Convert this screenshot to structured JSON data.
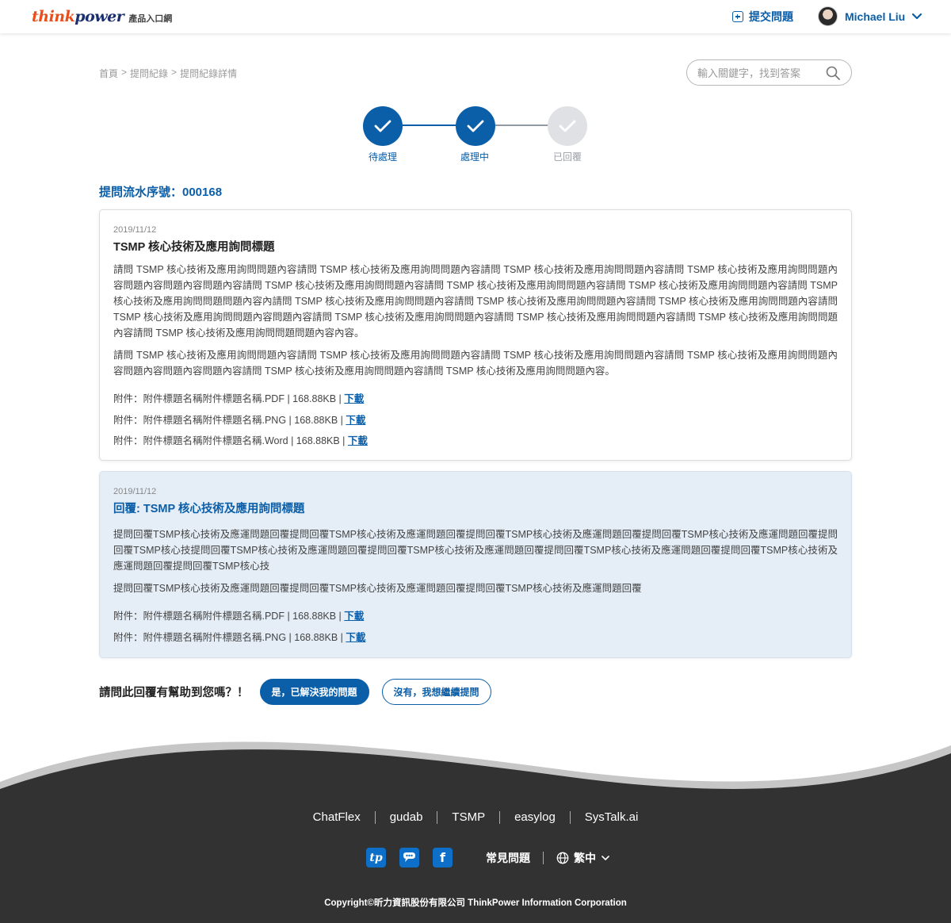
{
  "header": {
    "logo_text_prefix": "think",
    "logo_text_suffix": "power",
    "logo_subtitle": "產品入口網",
    "submit_question_label": "提交問題",
    "user_name": "Michael Liu"
  },
  "breadcrumb": {
    "items": [
      "首頁",
      "提問紀錄",
      "提問紀錄詳情"
    ],
    "separator": ">"
  },
  "search": {
    "placeholder": "輸入關鍵字，找到答案"
  },
  "steps": [
    {
      "label": "待處理",
      "status": "completed"
    },
    {
      "label": "處理中",
      "status": "completed"
    },
    {
      "label": "已回覆",
      "status": "pending"
    }
  ],
  "serial": {
    "label": "提問流水序號：000168"
  },
  "question": {
    "date": "2019/11/12",
    "title": "TSMP 核心技術及應用詢問標題",
    "paragraphs": [
      "請問 TSMP 核心技術及應用詢問問題內容請問 TSMP 核心技術及應用詢問問題內容請問 TSMP 核心技術及應用詢問問題內容請問 TSMP 核心技術及應用詢問問題內容問題內容問題內容問題內容請問 TSMP 核心技術及應用詢問問題內容請問 TSMP 核心技術及應用詢問問題內容請問 TSMP 核心技術及應用詢問問題內容請問 TSMP 核心技術及應用詢問問題問題內容內請問 TSMP 核心技術及應用詢問問題內容請問 TSMP 核心技術及應用詢問問題內容請問 TSMP 核心技術及應用詢問問題內容請問 TSMP 核心技術及應用詢問問題內容問題內容請問 TSMP 核心技術及應用詢問問題內容請問 TSMP 核心技術及應用詢問問題內容請問 TSMP 核心技術及應用詢問問題內容請問 TSMP 核心技術及應用詢問問題問題內容內容。",
      "請問 TSMP 核心技術及應用詢問問題內容請問 TSMP 核心技術及應用詢問問題內容請問 TSMP 核心技術及應用詢問問題內容請問 TSMP 核心技術及應用詢問問題內容問題內容問題內容問題內容請問 TSMP 核心技術及應用詢問問題內容請問 TSMP 核心技術及應用詢問問題內容。"
    ],
    "attachments": [
      {
        "text": "附件：附件標題名稱附件標題名稱.PDF | 168.88KB |",
        "link": "下載"
      },
      {
        "text": "附件：附件標題名稱附件標題名稱.PNG | 168.88KB |",
        "link": "下載"
      },
      {
        "text": "附件：附件標題名稱附件標題名稱.Word | 168.88KB |",
        "link": "下載"
      }
    ]
  },
  "reply": {
    "date": "2019/11/12",
    "title": "回覆: TSMP 核心技術及應用詢問標題",
    "paragraphs": [
      "提問回覆TSMP核心技術及應運問題回覆提問回覆TSMP核心技術及應運問題回覆提問回覆TSMP核心技術及應運問題回覆提問回覆TSMP核心技術及應運問題回覆提問回覆TSMP核心技提問回覆TSMP核心技術及應運問題回覆提問回覆TSMP核心技術及應運問題回覆提問回覆TSMP核心技術及應運問題回覆提問回覆TSMP核心技術及應運問題回覆提問回覆TSMP核心技",
      "提問回覆TSMP核心技術及應運問題回覆提問回覆TSMP核心技術及應運問題回覆提問回覆TSMP核心技術及應運問題回覆"
    ],
    "attachments": [
      {
        "text": "附件：附件標題名稱附件標題名稱.PDF | 168.88KB |",
        "link": "下載"
      },
      {
        "text": "附件：附件標題名稱附件標題名稱.PNG | 168.88KB |",
        "link": "下載"
      }
    ]
  },
  "feedback": {
    "question": "請問此回覆有幫助到您嗎？！",
    "yes_label": "是，已解決我的問題",
    "no_label": "沒有，我想繼續提問"
  },
  "footer": {
    "links": [
      "ChatFlex",
      "gudab",
      "TSMP",
      "easylog",
      "SysTalk.ai"
    ],
    "social": [
      {
        "icon": "tp-icon",
        "glyph": "tp"
      },
      {
        "icon": "chat-bubble-icon",
        "glyph": ""
      },
      {
        "icon": "facebook-icon",
        "glyph": "f"
      }
    ],
    "faq_label": "常見問題",
    "language_label": "繁中",
    "copyright": "Copyright©昕力資訊股份有限公司 ThinkPower Information Corporation"
  },
  "colors": {
    "primary": "#0b5ea8",
    "reply_bg": "#e5eef7",
    "footer_bg": "#323232",
    "step_pending": "#dfe1e4"
  }
}
